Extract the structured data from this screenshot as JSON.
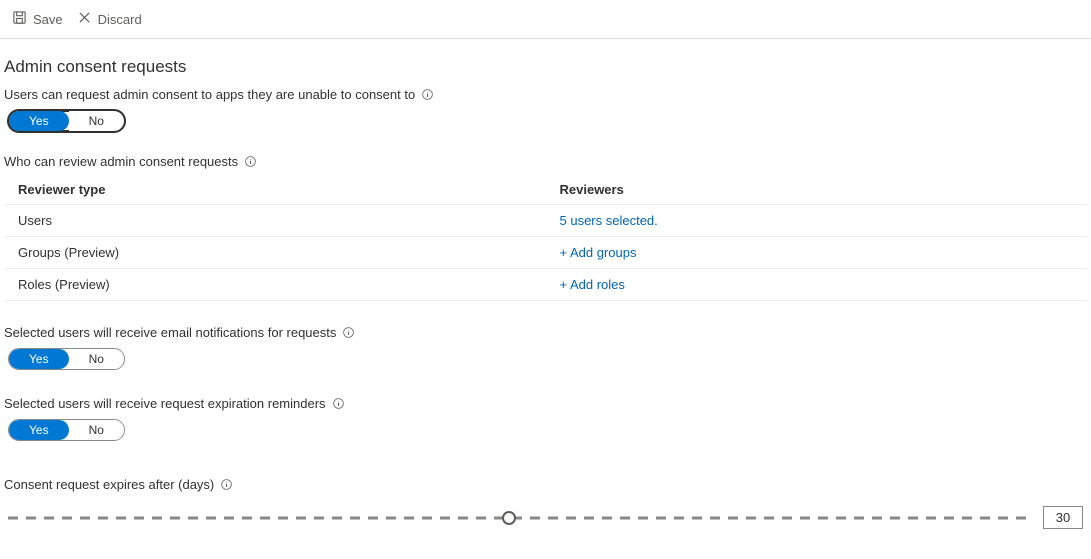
{
  "toolbar": {
    "save_label": "Save",
    "discard_label": "Discard"
  },
  "section": {
    "title": "Admin consent requests"
  },
  "settings": {
    "users_can_request": {
      "label": "Users can request admin consent to apps they are unable to consent to",
      "yes": "Yes",
      "no": "No",
      "value": "Yes",
      "focused": true
    },
    "who_can_review": {
      "label": "Who can review admin consent requests"
    },
    "email_notifications": {
      "label": "Selected users will receive email notifications for requests",
      "yes": "Yes",
      "no": "No",
      "value": "Yes"
    },
    "expiration_reminders": {
      "label": "Selected users will receive request expiration reminders",
      "yes": "Yes",
      "no": "No",
      "value": "Yes"
    },
    "expires_after": {
      "label": "Consent request expires after (days)",
      "value": "30",
      "min": 1,
      "max": 60
    }
  },
  "reviewer_table": {
    "col_type": "Reviewer type",
    "col_reviewers": "Reviewers",
    "rows": [
      {
        "type": "Users",
        "reviewers": "5 users selected."
      },
      {
        "type": "Groups (Preview)",
        "reviewers": "+ Add groups"
      },
      {
        "type": "Roles (Preview)",
        "reviewers": "+ Add roles"
      }
    ]
  }
}
